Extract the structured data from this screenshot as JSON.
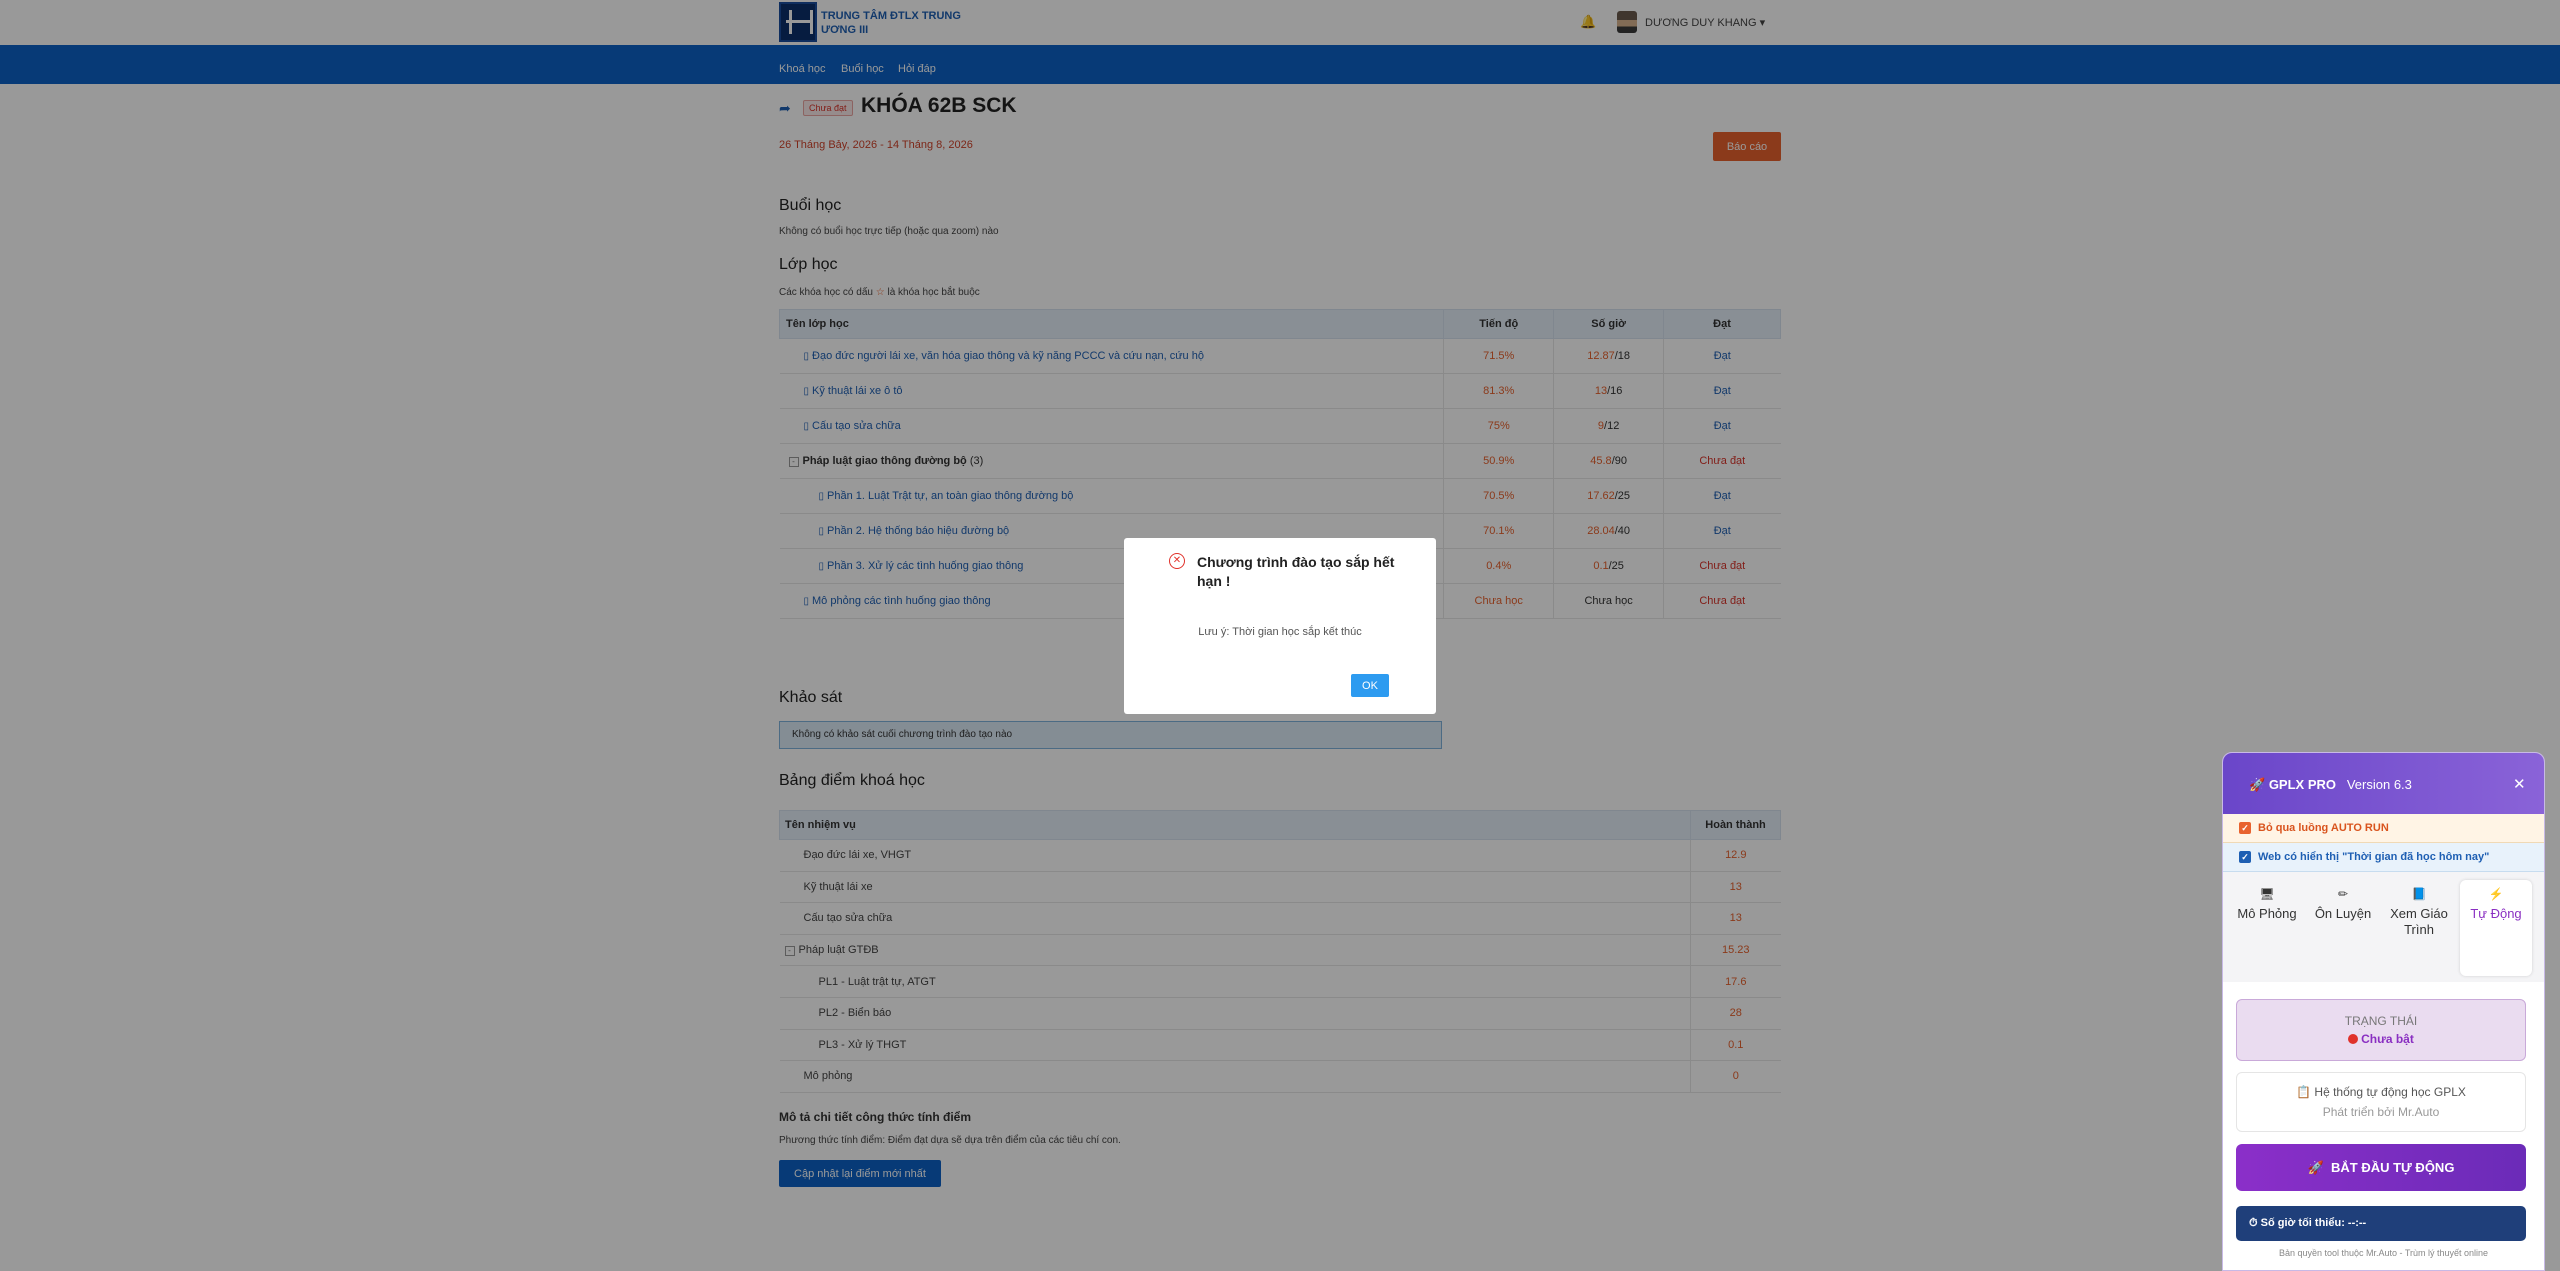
{
  "header": {
    "brand": "TRUNG TÂM ĐTLX TRUNG ƯƠNG III",
    "bell_icon": "bell-icon",
    "user_name": "DƯƠNG DUY KHANG ▾"
  },
  "nav": {
    "items": [
      "Khoá học",
      "Buổi học",
      "Hỏi đáp"
    ]
  },
  "course": {
    "status_badge": "Chưa đạt",
    "title": "KHÓA 62B SCK",
    "dates": "26 Tháng Bảy, 2026 - 14 Tháng 8, 2026",
    "report_button": "Báo cáo"
  },
  "sessions": {
    "heading": "Buổi học",
    "note": "Không có buổi học trực tiếp (hoặc qua zoom) nào"
  },
  "classes": {
    "heading": "Lớp học",
    "note_before": "Các khóa học có dấu",
    "note_star": "☆",
    "note_after": "là khóa học bắt buộc",
    "columns": [
      "Tên lớp học",
      "Tiến độ",
      "Số giờ",
      "Đạt"
    ],
    "rows": [
      {
        "name": "Đạo đức người lái xe, văn hóa giao thông và kỹ năng PCCC và cứu nạn, cứu hộ",
        "progress": "71.5%",
        "hours_done": "12.87",
        "hours_total": "/18",
        "result": "Đạt"
      },
      {
        "name": "Kỹ thuật lái xe ô tô",
        "progress": "81.3%",
        "hours_done": "13",
        "hours_total": "/16",
        "result": "Đạt"
      },
      {
        "name": "Cấu tạo sửa chữa",
        "progress": "75%",
        "hours_done": "9",
        "hours_total": "/12",
        "result": "Đạt"
      },
      {
        "name": "Pháp luật giao thông đường bộ",
        "count": "(3)",
        "progress": "50.9%",
        "hours_done": "45.8",
        "hours_total": "/90",
        "result": "Chưa đạt"
      },
      {
        "name": "Phần 1. Luật Trật tự, an toàn giao thông đường bộ",
        "progress": "70.5%",
        "hours_done": "17.62",
        "hours_total": "/25",
        "result": "Đạt"
      },
      {
        "name": "Phần 2. Hệ thống báo hiệu đường bộ",
        "progress": "70.1%",
        "hours_done": "28.04",
        "hours_total": "/40",
        "result": "Đạt"
      },
      {
        "name": "Phần 3. Xử lý các tình huống giao thông",
        "progress": "0.4%",
        "hours_done": "0.1",
        "hours_total": "/25",
        "result": "Chưa đạt"
      },
      {
        "name": "Mô phỏng các tình huống giao thông",
        "progress": "Chưa học",
        "hours_text": "Chưa học",
        "result": "Chưa đạt"
      }
    ]
  },
  "survey": {
    "heading": "Khảo sát",
    "note": "Không có khảo sát cuối chương trình đào tạo nào"
  },
  "scores": {
    "heading": "Bảng điểm khoá học",
    "columns": [
      "Tên nhiệm vụ",
      "Hoàn thành"
    ],
    "rows": [
      {
        "name": "Đạo đức lái xe, VHGT",
        "value": "12.9"
      },
      {
        "name": "Kỹ thuật lái xe",
        "value": "13"
      },
      {
        "name": "Cấu tạo sửa chữa",
        "value": "13"
      },
      {
        "name": "Pháp luật GTĐB",
        "value": "15.23"
      },
      {
        "name": "PL1 - Luật trật tự, ATGT",
        "value": "17.6"
      },
      {
        "name": "PL2 - Biển báo",
        "value": "28"
      },
      {
        "name": "PL3 - Xử lý THGT",
        "value": "0.1"
      },
      {
        "name": "Mô phỏng",
        "value": "0"
      }
    ],
    "formula_heading": "Mô tả chi tiết công thức tính điểm",
    "formula_text": "Phương thức tính điểm: Điểm đạt dựa sẽ dựa trên điểm của các tiêu chí con.",
    "update_button": "Cập nhật lại điểm mới nhất"
  },
  "modal": {
    "title": "Chương trình đào tạo sắp hết hạn !",
    "message": "Lưu ý: Thời gian học sắp kết thúc",
    "ok": "OK"
  },
  "widget": {
    "name": "GPLX PRO",
    "version": "Version 6.3",
    "close": "✕",
    "opt1": "Bỏ qua luồng AUTO RUN",
    "opt2": "Web có hiển thị \"Thời gian đã học hôm nay\"",
    "tabs": [
      "Mô Phỏng",
      "Ôn Luyện",
      "Xem Giáo Trình",
      "Tự Động"
    ],
    "status_label": "TRẠNG THÁI",
    "status_value": "Chưa bật",
    "info_title": "Hệ thống tự động học GPLX",
    "info_sub": "Phát triển bởi Mr.Auto",
    "start_button": "BẮT ĐẦU TỰ ĐỘNG",
    "min_hours": "Số giờ tối thiểu: --:--",
    "footer": "Bản quyền tool thuộc Mr.Auto - Trùm lý thuyết online",
    "colors": {
      "accent": "#8a2fc2",
      "header": "#6a46c9"
    }
  }
}
